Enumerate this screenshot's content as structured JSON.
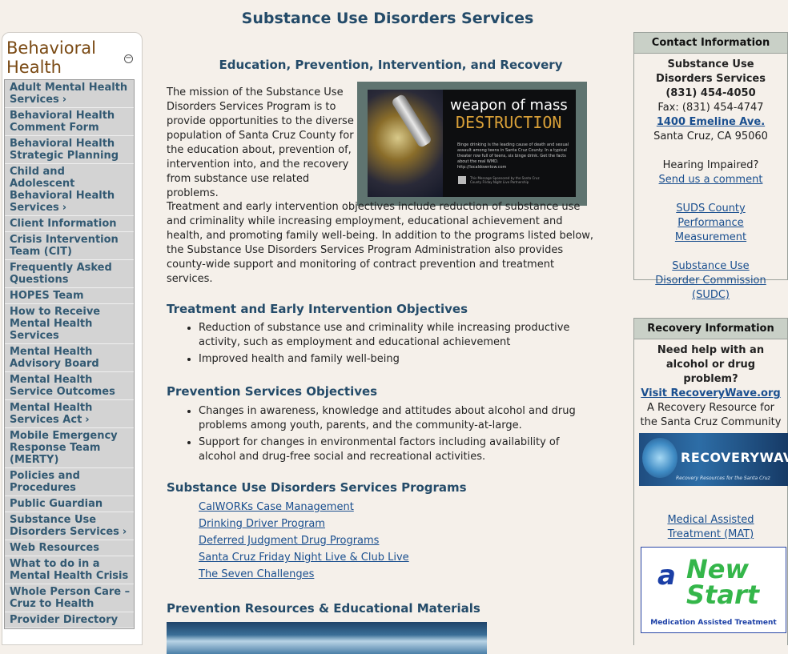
{
  "page": {
    "title": "Substance Use Disorders Services"
  },
  "nav": {
    "title": "Behavioral Health",
    "toggle": "−",
    "items": [
      {
        "label": "Adult Mental Health Services",
        "arrow": "›"
      },
      {
        "label": "Behavioral Health Comment Form",
        "arrow": ""
      },
      {
        "label": "Behavioral Health Strategic Planning",
        "arrow": ""
      },
      {
        "label": "Child and Adolescent Behavioral Health Services",
        "arrow": "›"
      },
      {
        "label": "Client Information",
        "arrow": ""
      },
      {
        "label": "Crisis Intervention Team (CIT)",
        "arrow": ""
      },
      {
        "label": "Frequently Asked Questions",
        "arrow": ""
      },
      {
        "label": "HOPES Team",
        "arrow": ""
      },
      {
        "label": "How to Receive Mental Health Services",
        "arrow": ""
      },
      {
        "label": "Mental Health Advisory Board",
        "arrow": ""
      },
      {
        "label": "Mental Health Service Outcomes",
        "arrow": ""
      },
      {
        "label": "Mental Health Services Act",
        "arrow": "›"
      },
      {
        "label": "Mobile Emergency Response Team (MERTY)",
        "arrow": ""
      },
      {
        "label": "Policies and Procedures",
        "arrow": ""
      },
      {
        "label": "Public Guardian",
        "arrow": ""
      },
      {
        "label": "Substance Use Disorders Services",
        "arrow": "›"
      },
      {
        "label": "Web Resources",
        "arrow": ""
      },
      {
        "label": "What to do in a Mental Health Crisis",
        "arrow": ""
      },
      {
        "label": "Whole Person Care – Cruz to Health",
        "arrow": ""
      },
      {
        "label": "Provider Directory",
        "arrow": ""
      }
    ]
  },
  "main": {
    "subtitle": "Education, Prevention, Intervention, and Recovery",
    "intro": "The mission of the Substance Use Disorders Services Program is to provide opportunities to the diverse population of Santa Cruz County for the education about, prevention of, intervention into, and the recovery from substance use related problems.",
    "poster": {
      "line1": "weapon of mass",
      "line2": "DESTRUCTION",
      "body": "Binge drinking is the leading cause of death and sexual assault among teens in Santa Cruz County. In a typical theater row full of teens, six binge drink. Get the facts about the real WMD.",
      "url": "http://localdowntow.com",
      "footer": "This Message Sponsored by the Santa Cruz County Friday Night Live Partnership"
    },
    "treatment_text": "Treatment and early intervention objectives include reduction of substance use and criminality while increasing employment, educational achievement and health, and promoting family well-being.  In addition to the programs listed below, the Substance Use Disorders Services Program Administration also provides county-wide support and monitoring of contract prevention and treatment services.",
    "treat_heading": "Treatment and Early Intervention Objectives",
    "treat_items": [
      "Reduction of substance use and criminality while increasing productive activity, such as employment and educational achievement",
      "Improved health and family well-being"
    ],
    "prev_heading": "Prevention Services Objectives",
    "prev_items": [
      "Changes in awareness, knowledge and attitudes about alcohol and drug problems among youth, parents, and the community-at-large.",
      "Support for changes in environmental factors including availability of alcohol and drug-free social and recreational activities."
    ],
    "prog_heading": "Substance Use Disorders Services Programs",
    "programs": [
      "CalWORKs Case Management",
      "Drinking Driver Program",
      "Deferred Judgment Drug Programs",
      "Santa Cruz Friday Night Live & Club Live",
      "The Seven Challenges"
    ],
    "res_heading": "Prevention Resources & Educational Materials"
  },
  "contact": {
    "heading": "Contact Information",
    "org": "Substance Use Disorders Services",
    "phone": "(831) 454-4050",
    "fax": "Fax: (831) 454-4747",
    "address_link": "1400 Emeline Ave.",
    "city": "Santa Cruz, CA 95060",
    "hearing": "Hearing Impaired?",
    "comment_link": "Send us a comment",
    "suds_link": "SUDS County Performance Measurement",
    "sudc_link": "Substance Use Disorder Commission (SUDC)"
  },
  "recovery": {
    "heading": "Recovery Information",
    "question": "Need help with an alcohol or drug problem?",
    "visit_link": "Visit RecoveryWave.org",
    "resource": "A Recovery Resource for the Santa Cruz Community",
    "banner_text": "RECOVERYWAVE",
    "banner_sub": "Recovery Resources for the Santa Cruz Community",
    "mat_link": "Medical Assisted Treatment (MAT)",
    "ns_a": "a",
    "ns_new": "New",
    "ns_start": "Start",
    "ns_caption": "Medication Assisted Treatment"
  }
}
